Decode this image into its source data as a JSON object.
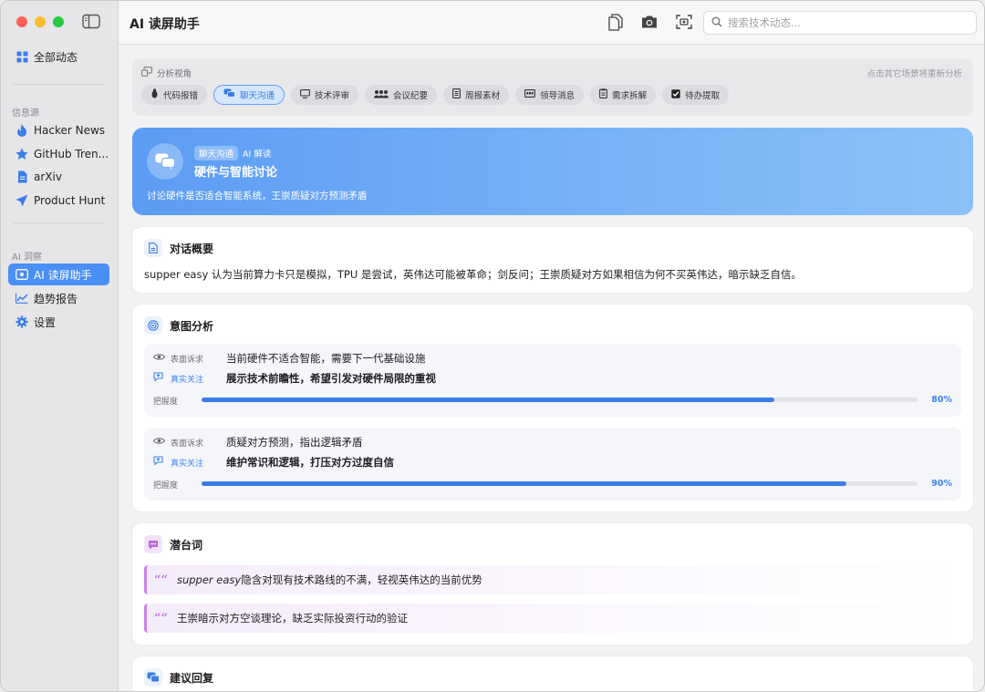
{
  "sidebar": {
    "top_item": "全部动态",
    "sections": [
      {
        "label": "信息源",
        "items": [
          "Hacker News",
          "GitHub Tren...",
          "arXiv",
          "Product Hunt"
        ]
      },
      {
        "label": "AI 洞察",
        "items": [
          "AI 读屏助手",
          "趋势报告",
          "设置"
        ]
      }
    ],
    "active_item": "AI 读屏助手"
  },
  "header": {
    "title": "AI 读屏助手",
    "search_placeholder": "搜索技术动态..."
  },
  "perspective": {
    "label": "分析视角",
    "hint": "点击其它场景将重新分析",
    "chips": [
      "代码报错",
      "聊天沟通",
      "技术评审",
      "会议纪要",
      "周报素材",
      "领导消息",
      "需求拆解",
      "待办提取"
    ],
    "active": "聊天沟通"
  },
  "hero": {
    "tag": "聊天沟通",
    "tag_suffix": "AI 解读",
    "title": "硬件与智能讨论",
    "subtitle": "讨论硬件是否适合智能系统，王崇质疑对方预测矛盾",
    "gradient": [
      "#5b9cf4",
      "#8cc0f8"
    ]
  },
  "summary": {
    "title": "对话概要",
    "text": "supper easy 认为当前算力卡只是模拟，TPU 是尝试，英伟达可能被革命；剑反问；王崇质疑对方如果相信为何不买英伟达，暗示缺乏自信。"
  },
  "intent": {
    "title": "意图分析",
    "surface_label": "表面诉求",
    "real_label": "真实关注",
    "confidence_label": "把握度",
    "items": [
      {
        "surface": "当前硬件不适合智能，需要下一代基础设施",
        "real": "展示技术前瞻性，希望引发对硬件局限的重视",
        "confidence": 0.8,
        "confidence_text": "80%"
      },
      {
        "surface": "质疑对方预测，指出逻辑矛盾",
        "real": "维护常识和逻辑，打压对方过度自信",
        "confidence": 0.9,
        "confidence_text": "90%"
      }
    ]
  },
  "subtext": {
    "title": "潜台词",
    "items": [
      {
        "lead": "supper easy",
        "rest": "隐含对现有技术路线的不满，轻视英伟达的当前优势"
      },
      {
        "lead": "",
        "rest": "王崇暗示对方空谈理论，缺乏实际投资行动的验证"
      }
    ]
  },
  "suggest": {
    "title": "建议回复"
  },
  "colors": {
    "accent": "#4a8ff5",
    "subtext_accent": "#c984e8"
  }
}
